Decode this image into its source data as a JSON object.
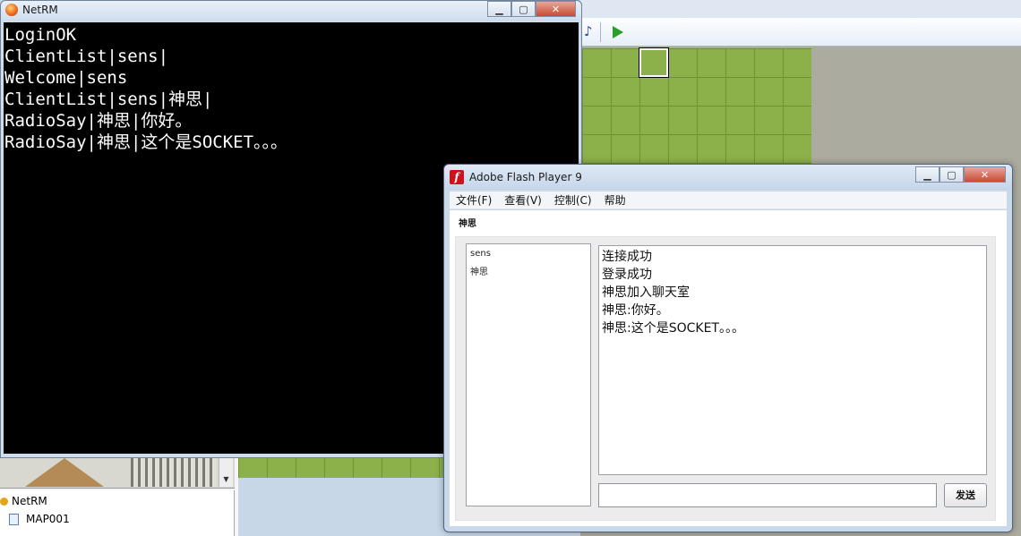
{
  "editor": {
    "tree": {
      "root": "NetRM",
      "child": "MAP001"
    }
  },
  "netrm": {
    "title": "NetRM",
    "lines": [
      "LoginOK",
      "ClientList|sens|",
      "Welcome|sens",
      "ClientList|sens|神思|",
      "RadioSay|神思|你好。",
      "RadioSay|神思|这个是SOCKET。。。"
    ]
  },
  "flash": {
    "title": "Adobe Flash Player 9",
    "menu": [
      "文件(F)",
      "查看(V)",
      "控制(C)",
      "帮助"
    ],
    "current_user": "神思",
    "users": [
      "sens",
      "神思"
    ],
    "messages": [
      "连接成功",
      "登录成功",
      "神思加入聊天室",
      "神思:你好。",
      "神思:这个是SOCKET。。。"
    ],
    "input_value": "",
    "send_label": "发送"
  },
  "colors": {
    "console_bg": "#000000",
    "console_fg": "#ffffff",
    "grass": "#8cb04a",
    "play": "#2aa02a",
    "flash_logo": "#c8141a"
  },
  "icons": [
    "note-icon",
    "play-icon",
    "netrm-app-icon",
    "flash-app-icon",
    "folder-icon",
    "map-page-icon",
    "minimize-icon",
    "maximize-icon",
    "close-icon"
  ]
}
